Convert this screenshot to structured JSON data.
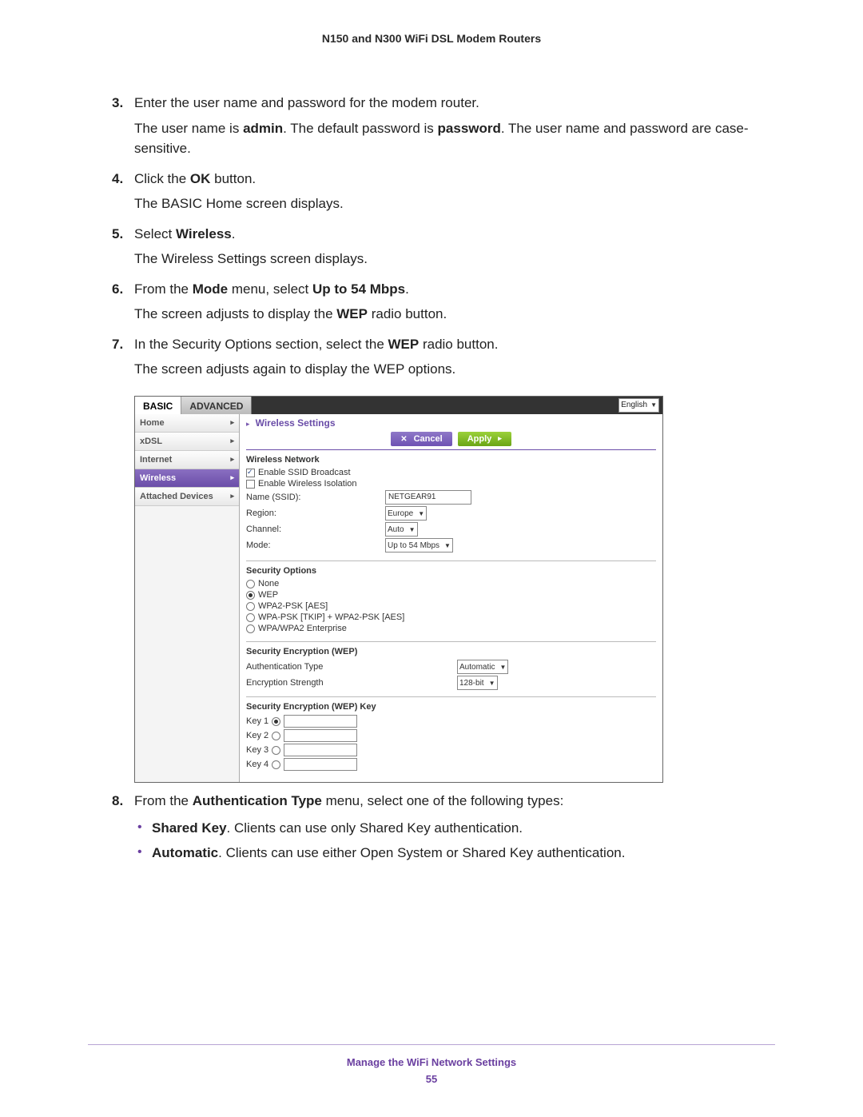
{
  "doc": {
    "title": "N150 and N300 WiFi DSL Modem Routers",
    "footer_section": "Manage the WiFi Network Settings",
    "page_number": "55"
  },
  "steps": {
    "3": {
      "num": "3.",
      "line": "Enter the user name and password for the modem router.",
      "p1_a": "The user name is ",
      "p1_b": "admin",
      "p1_c": ". The default password is ",
      "p1_d": "password",
      "p1_e": ". The user name and password are case-sensitive."
    },
    "4": {
      "num": "4.",
      "a": "Click the ",
      "b": "OK",
      "c": " button.",
      "p": "The BASIC Home screen displays."
    },
    "5": {
      "num": "5.",
      "a": "Select ",
      "b": "Wireless",
      "c": ".",
      "p": "The Wireless Settings screen displays."
    },
    "6": {
      "num": "6.",
      "a": "From the ",
      "b": "Mode",
      "c": " menu, select ",
      "d": "Up to 54 Mbps",
      "e": ".",
      "p_a": "The screen adjusts to display the ",
      "p_b": "WEP",
      "p_c": " radio button."
    },
    "7": {
      "num": "7.",
      "a": "In the Security Options section, select the ",
      "b": "WEP",
      "c": " radio button.",
      "p": "The screen adjusts again to display the WEP options."
    },
    "8": {
      "num": "8.",
      "a": "From the ",
      "b": "Authentication Type",
      "c": " menu, select one of the following types:",
      "bul1_b": "Shared Key",
      "bul1_t": ". Clients can use only Shared Key authentication.",
      "bul2_b": "Automatic",
      "bul2_t": ". Clients can use either Open System or Shared Key authentication."
    }
  },
  "ui": {
    "tabs": {
      "basic": "BASIC",
      "advanced": "ADVANCED"
    },
    "language": "English",
    "sidebar": {
      "home": "Home",
      "xdsl": "xDSL",
      "internet": "Internet",
      "wireless": "Wireless",
      "attached": "Attached Devices"
    },
    "content_title": "Wireless Settings",
    "buttons": {
      "cancel": "Cancel",
      "apply": "Apply"
    },
    "wn_header": "Wireless Network",
    "enable_ssid": "Enable SSID Broadcast",
    "enable_iso": "Enable Wireless Isolation",
    "ssid_label": "Name (SSID):",
    "ssid_value": "NETGEAR91",
    "region_label": "Region:",
    "region_value": "Europe",
    "channel_label": "Channel:",
    "channel_value": "Auto",
    "mode_label": "Mode:",
    "mode_value": "Up to 54 Mbps",
    "sec_header": "Security Options",
    "sec": {
      "none": "None",
      "wep": "WEP",
      "wpa2": "WPA2-PSK [AES]",
      "mixed": "WPA-PSK [TKIP] + WPA2-PSK [AES]",
      "ent": "WPA/WPA2 Enterprise"
    },
    "wep_enc_header": "Security Encryption (WEP)",
    "auth_type_lbl": "Authentication Type",
    "auth_type_val": "Automatic",
    "enc_strength_lbl": "Encryption Strength",
    "enc_strength_val": "128-bit",
    "wep_key_header": "Security Encryption (WEP) Key",
    "keys": {
      "1": "Key 1",
      "2": "Key 2",
      "3": "Key 3",
      "4": "Key 4"
    }
  }
}
